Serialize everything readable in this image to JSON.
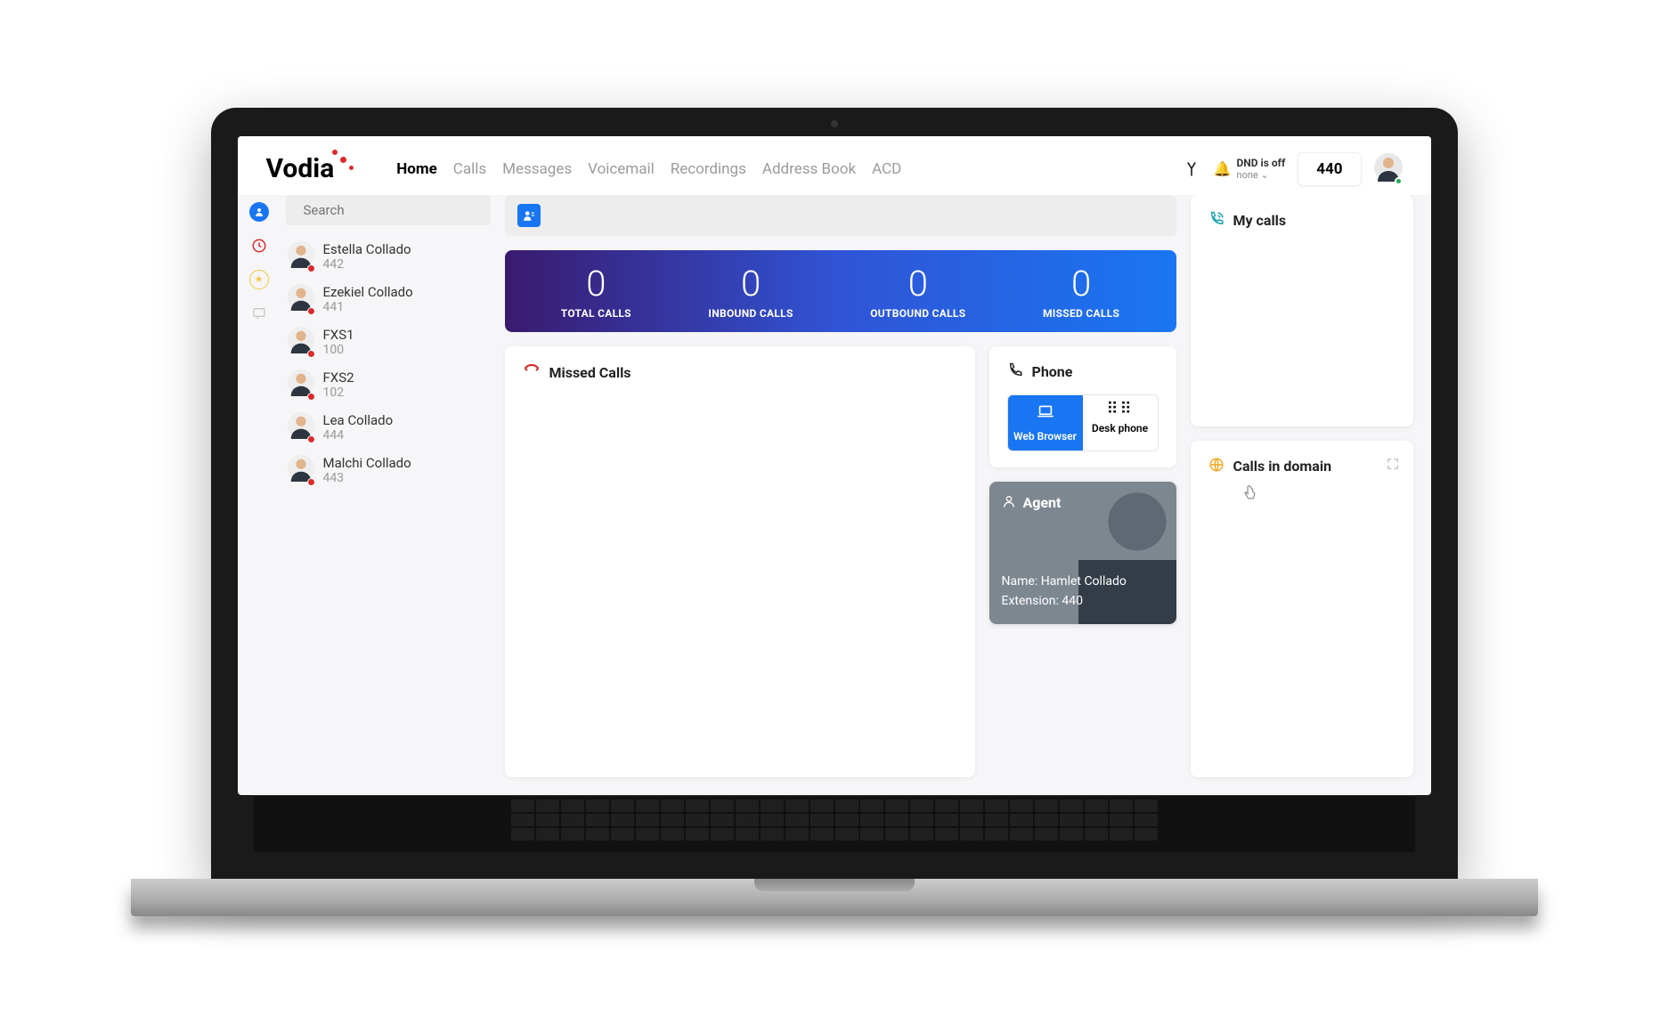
{
  "brand": "Vodia",
  "nav": {
    "items": [
      "Home",
      "Calls",
      "Messages",
      "Voicemail",
      "Recordings",
      "Address Book",
      "ACD"
    ],
    "active": "Home"
  },
  "header": {
    "dnd_label": "DND is off",
    "dnd_value": "none",
    "extension": "440"
  },
  "search": {
    "placeholder": "Search"
  },
  "contacts": [
    {
      "name": "Estella Collado",
      "ext": "442"
    },
    {
      "name": "Ezekiel Collado",
      "ext": "441"
    },
    {
      "name": "FXS1",
      "ext": "100"
    },
    {
      "name": "FXS2",
      "ext": "102"
    },
    {
      "name": "Lea Collado",
      "ext": "444"
    },
    {
      "name": "Malchi Collado",
      "ext": "443"
    }
  ],
  "stats": {
    "total": {
      "value": "0",
      "label": "TOTAL CALLS"
    },
    "inbound": {
      "value": "0",
      "label": "INBOUND CALLS"
    },
    "outbound": {
      "value": "0",
      "label": "OUTBOUND CALLS"
    },
    "missed": {
      "value": "0",
      "label": "MISSED CALLS"
    }
  },
  "missed_card": {
    "title": "Missed Calls"
  },
  "phone_card": {
    "title": "Phone",
    "web": "Web Browser",
    "desk": "Desk phone"
  },
  "agent_card": {
    "title": "Agent",
    "name_label": "Name:",
    "name_value": "Hamlet Collado",
    "ext_label": "Extension:",
    "ext_value": "440"
  },
  "mycalls_card": {
    "title": "My calls"
  },
  "domain_card": {
    "title": "Calls in domain"
  }
}
